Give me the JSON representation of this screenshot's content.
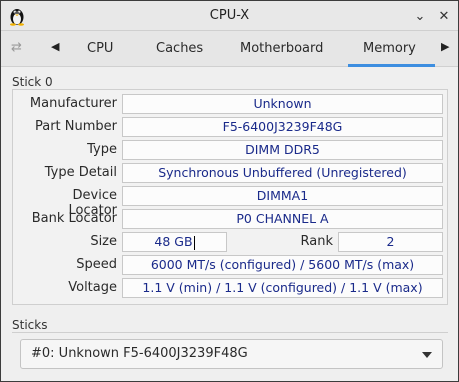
{
  "window": {
    "title": "CPU-X",
    "icon": "tux-icon",
    "minimize_glyph": "⌄",
    "close_glyph": "✕"
  },
  "tabs": {
    "items": [
      "CPU",
      "Caches",
      "Motherboard",
      "Memory"
    ],
    "active": "Memory",
    "prev_glyph": "◀",
    "next_glyph": "▶",
    "refresh_glyph": "⇄"
  },
  "stick": {
    "group_label": "Stick 0",
    "manufacturer_label": "Manufacturer",
    "manufacturer": "Unknown",
    "part_number_label": "Part Number",
    "part_number": "F5-6400J3239F48G",
    "type_label": "Type",
    "type": "DIMM DDR5",
    "type_detail_label": "Type Detail",
    "type_detail": "Synchronous Unbuffered (Unregistered)",
    "device_locator_label": "Device Locator",
    "device_locator": "DIMMA1",
    "bank_locator_label": "Bank Locator",
    "bank_locator": "P0 CHANNEL A",
    "size_label": "Size",
    "size": "48 GB",
    "rank_label": "Rank",
    "rank": "2",
    "speed_label": "Speed",
    "speed": "6000 MT/s (configured) / 5600 MT/s (max)",
    "voltage_label": "Voltage",
    "voltage": "1.1 V (min) / 1.1 V (configured) / 1.1 V (max)"
  },
  "sticks": {
    "group_label": "Sticks",
    "selected": "#0: Unknown F5-6400J3239F48G"
  },
  "colors": {
    "accent": "#3d8ee0",
    "value_text": "#1a2a8a"
  }
}
